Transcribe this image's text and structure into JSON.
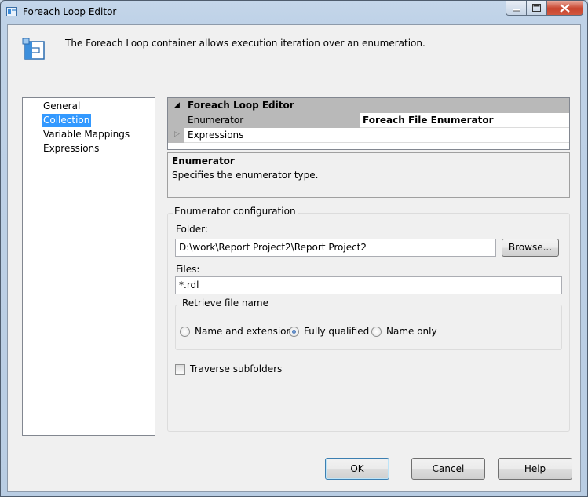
{
  "window": {
    "title": "Foreach Loop Editor"
  },
  "header": {
    "description": "The Foreach Loop container allows execution iteration over an enumeration."
  },
  "nav": {
    "items": [
      {
        "label": "General"
      },
      {
        "label": "Collection",
        "selected": true
      },
      {
        "label": "Variable Mappings"
      },
      {
        "label": "Expressions"
      }
    ]
  },
  "grid": {
    "category": "Foreach Loop Editor",
    "rows": [
      {
        "name": "Enumerator",
        "value": "Foreach File Enumerator"
      },
      {
        "name": "Expressions",
        "value": ""
      }
    ]
  },
  "description": {
    "title": "Enumerator",
    "text": "Specifies the enumerator type."
  },
  "config": {
    "legend": "Enumerator configuration",
    "folder_label": "Folder:",
    "folder_value": "D:\\work\\Report Project2\\Report Project2",
    "browse_label": "Browse...",
    "files_label": "Files:",
    "files_value": "*.rdl",
    "retrieve": {
      "legend": "Retrieve file name",
      "options": [
        {
          "label": "Name and extension",
          "selected": false
        },
        {
          "label": "Fully qualified",
          "selected": true
        },
        {
          "label": "Name only",
          "selected": false
        }
      ]
    },
    "traverse_label": "Traverse subfolders",
    "traverse_checked": false
  },
  "buttons": {
    "ok": "OK",
    "cancel": "Cancel",
    "help": "Help"
  },
  "colors": {
    "selection": "#3399ff",
    "grid_category": "#b9b9b9"
  }
}
